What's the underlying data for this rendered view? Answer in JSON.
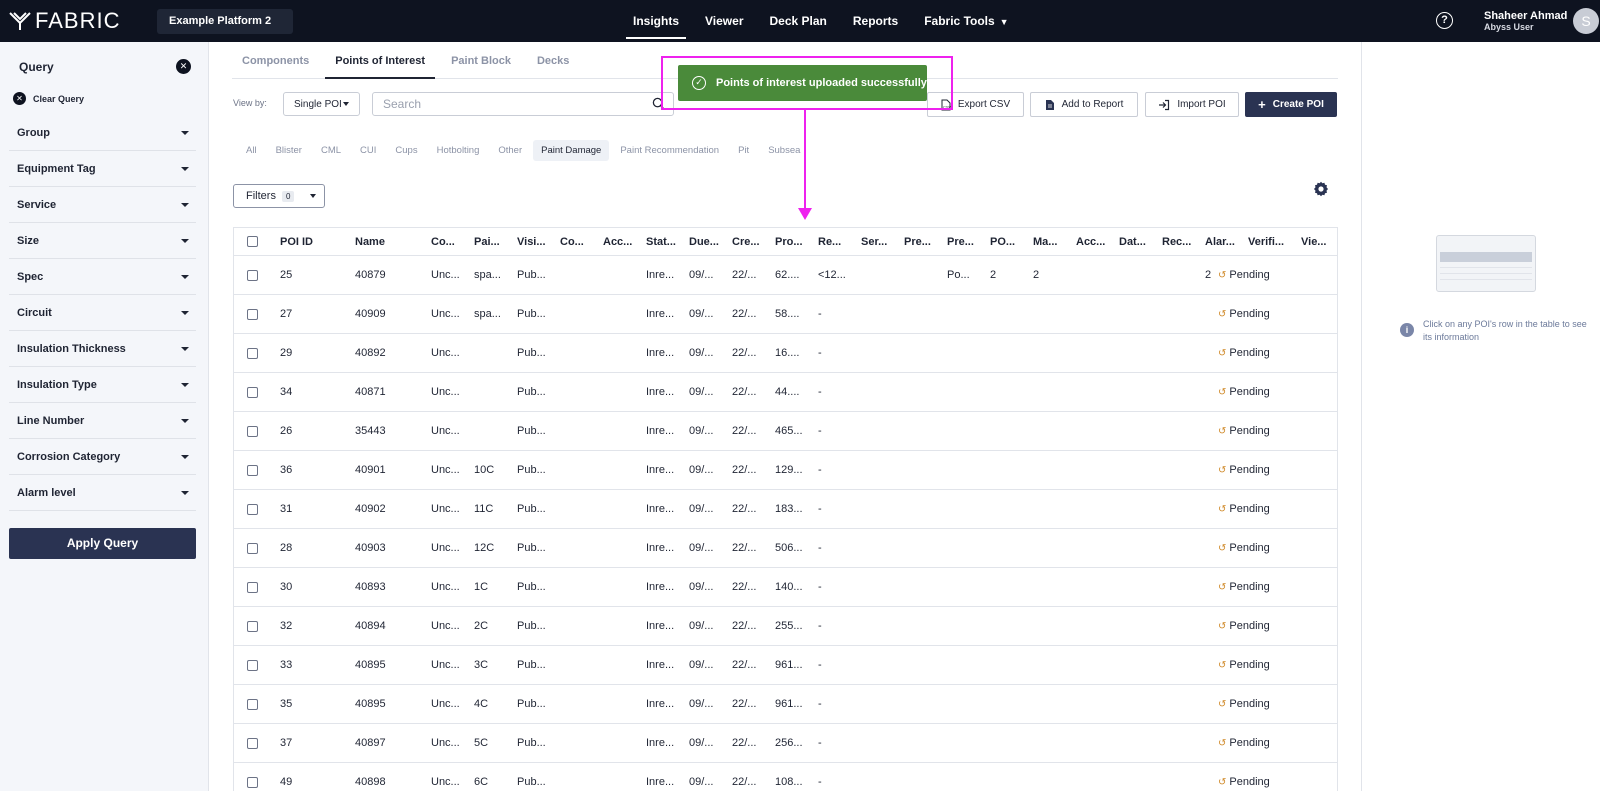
{
  "topbar": {
    "logo": "FABRIC",
    "platform": "Example Platform 2",
    "nav": [
      "Insights",
      "Viewer",
      "Deck Plan",
      "Reports",
      "Fabric Tools"
    ],
    "help_icon": "question-circle-icon",
    "user_name": "Shaheer Ahmad",
    "user_role": "Abyss User",
    "avatar_initial": "S"
  },
  "sidebar": {
    "title": "Query",
    "clear_label": "Clear Query",
    "items": [
      "Group",
      "Equipment Tag",
      "Service",
      "Size",
      "Spec",
      "Circuit",
      "Insulation Thickness",
      "Insulation Type",
      "Line Number",
      "Corrosion Category",
      "Alarm level"
    ],
    "apply_label": "Apply Query"
  },
  "tabs": [
    "Components",
    "Points of Interest",
    "Paint Block",
    "Decks"
  ],
  "toolbar": {
    "view_by_label": "View by:",
    "view_value": "Single POI",
    "search_placeholder": "Search",
    "export_label": "Export CSV",
    "add_report_label": "Add to Report",
    "import_label": "Import POI",
    "create_label": "Create POI"
  },
  "toast": {
    "message": "Points of interest uploaded successfully",
    "color": "#4a8a3a"
  },
  "annotation_color": "#ee21ee",
  "chips": [
    "All",
    "Blister",
    "CML",
    "CUI",
    "Cups",
    "Hotbolting",
    "Other",
    "Paint Damage",
    "Paint Recommendation",
    "Pit",
    "Subsea"
  ],
  "filters": {
    "label": "Filters",
    "count": "0"
  },
  "table": {
    "headers": [
      "POI ID",
      "Name",
      "Co...",
      "Pai...",
      "Visi...",
      "Co...",
      "Acc...",
      "Stat...",
      "Due...",
      "Cre...",
      "Pro...",
      "Re...",
      "Ser...",
      "Pre...",
      "Pre...",
      "PO...",
      "Ma...",
      "Acc...",
      "Dat...",
      "Rec...",
      "Alar...",
      "Verifi...",
      "Vie..."
    ],
    "rows": [
      {
        "id": "25",
        "name": "40879",
        "co": "Unc...",
        "pai": "spa...",
        "visi": "Pub...",
        "stat": "Inre...",
        "due": "09/...",
        "cre": "22/...",
        "pro": "62....",
        "re": "<12...",
        "pre2": "Po...",
        "po": "2",
        "ma": "2",
        "alar": "2",
        "verif": "Pending"
      },
      {
        "id": "27",
        "name": "40909",
        "co": "Unc...",
        "pai": "spa...",
        "visi": "Pub...",
        "stat": "Inre...",
        "due": "09/...",
        "cre": "22/...",
        "pro": "58....",
        "re": "-",
        "pre2": "",
        "po": "",
        "ma": "",
        "alar": "",
        "verif": "Pending"
      },
      {
        "id": "29",
        "name": "40892",
        "co": "Unc...",
        "pai": "",
        "visi": "Pub...",
        "stat": "Inre...",
        "due": "09/...",
        "cre": "22/...",
        "pro": "16....",
        "re": "-",
        "pre2": "",
        "po": "",
        "ma": "",
        "alar": "",
        "verif": "Pending"
      },
      {
        "id": "34",
        "name": "40871",
        "co": "Unc...",
        "pai": "",
        "visi": "Pub...",
        "stat": "Inre...",
        "due": "09/...",
        "cre": "22/...",
        "pro": "44....",
        "re": "-",
        "pre2": "",
        "po": "",
        "ma": "",
        "alar": "",
        "verif": "Pending"
      },
      {
        "id": "26",
        "name": "35443",
        "co": "Unc...",
        "pai": "",
        "visi": "Pub...",
        "stat": "Inre...",
        "due": "09/...",
        "cre": "22/...",
        "pro": "465...",
        "re": "-",
        "pre2": "",
        "po": "",
        "ma": "",
        "alar": "",
        "verif": "Pending"
      },
      {
        "id": "36",
        "name": "40901",
        "co": "Unc...",
        "pai": "10C",
        "visi": "Pub...",
        "stat": "Inre...",
        "due": "09/...",
        "cre": "22/...",
        "pro": "129...",
        "re": "-",
        "pre2": "",
        "po": "",
        "ma": "",
        "alar": "",
        "verif": "Pending"
      },
      {
        "id": "31",
        "name": "40902",
        "co": "Unc...",
        "pai": "11C",
        "visi": "Pub...",
        "stat": "Inre...",
        "due": "09/...",
        "cre": "22/...",
        "pro": "183...",
        "re": "-",
        "pre2": "",
        "po": "",
        "ma": "",
        "alar": "",
        "verif": "Pending"
      },
      {
        "id": "28",
        "name": "40903",
        "co": "Unc...",
        "pai": "12C",
        "visi": "Pub...",
        "stat": "Inre...",
        "due": "09/...",
        "cre": "22/...",
        "pro": "506...",
        "re": "-",
        "pre2": "",
        "po": "",
        "ma": "",
        "alar": "",
        "verif": "Pending"
      },
      {
        "id": "30",
        "name": "40893",
        "co": "Unc...",
        "pai": "1C",
        "visi": "Pub...",
        "stat": "Inre...",
        "due": "09/...",
        "cre": "22/...",
        "pro": "140...",
        "re": "-",
        "pre2": "",
        "po": "",
        "ma": "",
        "alar": "",
        "verif": "Pending"
      },
      {
        "id": "32",
        "name": "40894",
        "co": "Unc...",
        "pai": "2C",
        "visi": "Pub...",
        "stat": "Inre...",
        "due": "09/...",
        "cre": "22/...",
        "pro": "255...",
        "re": "-",
        "pre2": "",
        "po": "",
        "ma": "",
        "alar": "",
        "verif": "Pending"
      },
      {
        "id": "33",
        "name": "40895",
        "co": "Unc...",
        "pai": "3C",
        "visi": "Pub...",
        "stat": "Inre...",
        "due": "09/...",
        "cre": "22/...",
        "pro": "961...",
        "re": "-",
        "pre2": "",
        "po": "",
        "ma": "",
        "alar": "",
        "verif": "Pending"
      },
      {
        "id": "35",
        "name": "40895",
        "co": "Unc...",
        "pai": "4C",
        "visi": "Pub...",
        "stat": "Inre...",
        "due": "09/...",
        "cre": "22/...",
        "pro": "961...",
        "re": "-",
        "pre2": "",
        "po": "",
        "ma": "",
        "alar": "",
        "verif": "Pending"
      },
      {
        "id": "37",
        "name": "40897",
        "co": "Unc...",
        "pai": "5C",
        "visi": "Pub...",
        "stat": "Inre...",
        "due": "09/...",
        "cre": "22/...",
        "pro": "256...",
        "re": "-",
        "pre2": "",
        "po": "",
        "ma": "",
        "alar": "",
        "verif": "Pending"
      },
      {
        "id": "49",
        "name": "40898",
        "co": "Unc...",
        "pai": "6C",
        "visi": "Pub...",
        "stat": "Inre...",
        "due": "09/...",
        "cre": "22/...",
        "pro": "108...",
        "re": "-",
        "pre2": "",
        "po": "",
        "ma": "",
        "alar": "",
        "verif": "Pending"
      }
    ]
  },
  "right_panel": {
    "info_text": "Click on any POI's row in the table to see its information"
  }
}
